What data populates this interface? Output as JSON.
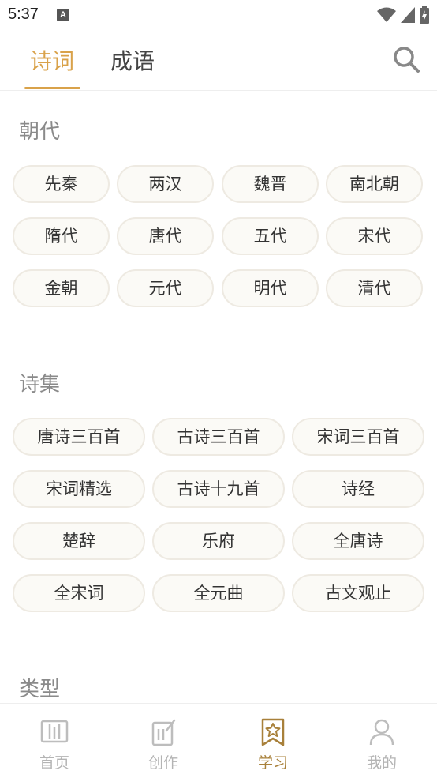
{
  "status": {
    "time": "5:37",
    "indicator": "A"
  },
  "tabs": [
    {
      "label": "诗词"
    },
    {
      "label": "成语"
    }
  ],
  "colors": {
    "accent": "#d9a24a",
    "active_nav": "#a8803a",
    "inactive": "#b4b4b4"
  },
  "sections": [
    {
      "title": "朝代",
      "items": [
        "先秦",
        "两汉",
        "魏晋",
        "南北朝",
        "隋代",
        "唐代",
        "五代",
        "宋代",
        "金朝",
        "元代",
        "明代",
        "清代"
      ]
    },
    {
      "title": "诗集",
      "items": [
        "唐诗三百首",
        "古诗三百首",
        "宋词三百首",
        "宋词精选",
        "古诗十九首",
        "诗经",
        "楚辞",
        "乐府",
        "全唐诗",
        "全宋词",
        "全元曲",
        "古文观止"
      ]
    },
    {
      "title": "类型"
    }
  ],
  "bottom_nav": [
    {
      "label": "首页",
      "icon": "home-book-icon"
    },
    {
      "label": "创作",
      "icon": "edit-icon"
    },
    {
      "label": "学习",
      "icon": "bookmark-star-icon",
      "active": true
    },
    {
      "label": "我的",
      "icon": "person-icon"
    }
  ]
}
